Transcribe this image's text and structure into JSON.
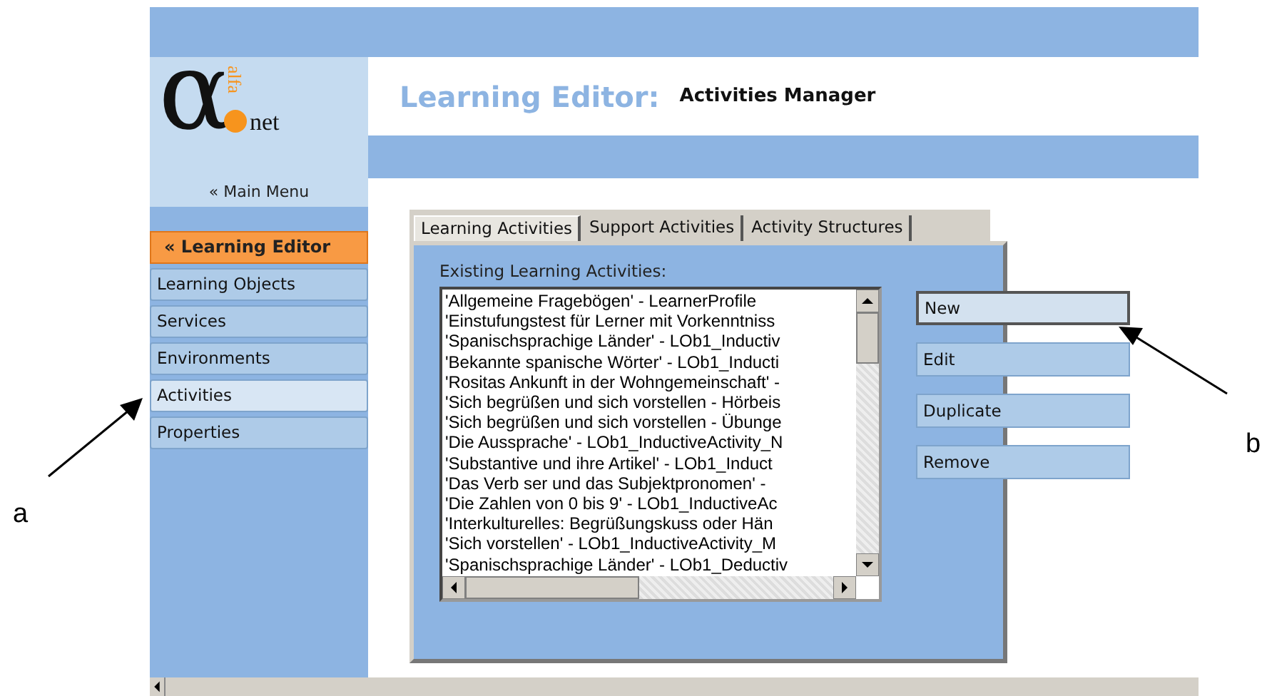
{
  "logo": {
    "symbol": "α",
    "vertical": "alfa",
    "suffix": "net"
  },
  "header": {
    "title": "Learning Editor:",
    "subtitle": "Activities Manager"
  },
  "main_menu": "« Main Menu",
  "sidebar": {
    "heading": "« Learning Editor",
    "items": [
      {
        "label": "Learning Objects",
        "selected": false
      },
      {
        "label": "Services",
        "selected": false
      },
      {
        "label": "Environments",
        "selected": false
      },
      {
        "label": "Activities",
        "selected": true
      },
      {
        "label": "Properties",
        "selected": false
      }
    ]
  },
  "tabs": [
    {
      "label": "Learning Activities",
      "selected": true
    },
    {
      "label": "Support Activities",
      "selected": false
    },
    {
      "label": "Activity Structures",
      "selected": false
    }
  ],
  "list": {
    "label": "Existing Learning Activities:",
    "items": [
      "'Allgemeine Fragebögen' - LearnerProfile",
      "'Einstufungstest für Lerner mit Vorkenntniss",
      "'Spanischsprachige Länder' - LOb1_Inductiv",
      "'Bekannte spanische Wörter' - LOb1_Inducti",
      "'Rositas Ankunft in der Wohngemeinschaft' -",
      "'Sich begrüßen und sich vorstellen - Hörbeis",
      "'Sich begrüßen und sich vorstellen - Übunge",
      "'Die Aussprache' - LOb1_InductiveActivity_N",
      "'Substantive und ihre Artikel' - LOb1_Induct",
      "'Das Verb ser und das Subjektpronomen' -",
      "'Die Zahlen von 0 bis 9' - LOb1_InductiveAc",
      "'Interkulturelles: Begrüßungskuss oder Hän",
      "'Sich vorstellen' - LOb1_InductiveActivity_M",
      "'Spanischsprachige Länder' - LOb1_Deductiv"
    ]
  },
  "buttons": [
    {
      "label": "New",
      "focused": true
    },
    {
      "label": "Edit",
      "focused": false
    },
    {
      "label": "Duplicate",
      "focused": false
    },
    {
      "label": "Remove",
      "focused": false
    }
  ],
  "annotations": [
    {
      "label": "a",
      "kind": "left"
    },
    {
      "label": "b",
      "kind": "right"
    }
  ]
}
